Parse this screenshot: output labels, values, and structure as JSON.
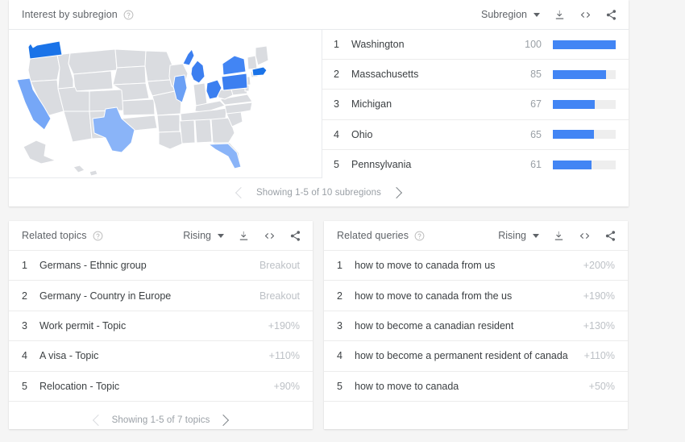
{
  "subregion_panel": {
    "title": "Interest by subregion",
    "help_icon": "help-circle-icon",
    "select_label": "Subregion",
    "tools": [
      "download-icon",
      "embed-icon",
      "share-icon"
    ],
    "rows": [
      {
        "rank": "1",
        "name": "Washington",
        "value": "100",
        "pct": 100
      },
      {
        "rank": "2",
        "name": "Massachusetts",
        "value": "85",
        "pct": 85
      },
      {
        "rank": "3",
        "name": "Michigan",
        "value": "67",
        "pct": 67
      },
      {
        "rank": "4",
        "name": "Ohio",
        "value": "65",
        "pct": 65
      },
      {
        "rank": "5",
        "name": "Pennsylvania",
        "value": "61",
        "pct": 61
      }
    ],
    "pager_text": "Showing 1-5 of 10 subregions",
    "map": {
      "base_color": "#dadce0",
      "border_color": "#ffffff",
      "highlights": [
        {
          "state": "Washington",
          "color": "#1a73e8"
        },
        {
          "state": "Massachusetts",
          "color": "#1a73e8"
        },
        {
          "state": "Michigan",
          "color": "#3c7ff0"
        },
        {
          "state": "Ohio",
          "color": "#3c7ff0"
        },
        {
          "state": "Pennsylvania",
          "color": "#3c7ff0"
        },
        {
          "state": "New York",
          "color": "#4285f4"
        },
        {
          "state": "Illinois",
          "color": "#6ba0f5"
        },
        {
          "state": "California",
          "color": "#76a7f7"
        },
        {
          "state": "Texas",
          "color": "#8ab4f8"
        },
        {
          "state": "Florida",
          "color": "#8ab4f8"
        }
      ]
    }
  },
  "related_topics_panel": {
    "title": "Related topics",
    "help_icon": "help-circle-icon",
    "select_label": "Rising",
    "tools": [
      "download-icon",
      "embed-icon",
      "share-icon"
    ],
    "rows": [
      {
        "rank": "1",
        "name": "Germans - Ethnic group",
        "value": "Breakout"
      },
      {
        "rank": "2",
        "name": "Germany - Country in Europe",
        "value": "Breakout"
      },
      {
        "rank": "3",
        "name": "Work permit - Topic",
        "value": "+190%"
      },
      {
        "rank": "4",
        "name": "A visa - Topic",
        "value": "+110%"
      },
      {
        "rank": "5",
        "name": "Relocation - Topic",
        "value": "+90%"
      }
    ],
    "pager_text": "Showing 1-5 of 7 topics"
  },
  "related_queries_panel": {
    "title": "Related queries",
    "help_icon": "help-circle-icon",
    "select_label": "Rising",
    "tools": [
      "download-icon",
      "embed-icon",
      "share-icon"
    ],
    "rows": [
      {
        "rank": "1",
        "name": "how to move to canada from us",
        "value": "+200%"
      },
      {
        "rank": "2",
        "name": "how to move to canada from the us",
        "value": "+190%"
      },
      {
        "rank": "3",
        "name": "how to become a canadian resident",
        "value": "+130%"
      },
      {
        "rank": "4",
        "name": "how to become a permanent resident of canada",
        "value": "+110%"
      },
      {
        "rank": "5",
        "name": "how to move to canada",
        "value": "+50%"
      }
    ],
    "pager_text": ""
  },
  "colors": {
    "page_background": "#f5f5f5",
    "card_background": "#ffffff",
    "bar_fill": "#4285f4",
    "bar_track": "#eeeeee",
    "text_primary": "#3c4043",
    "text_secondary": "#5f6368",
    "text_muted": "#9aa0a6"
  }
}
